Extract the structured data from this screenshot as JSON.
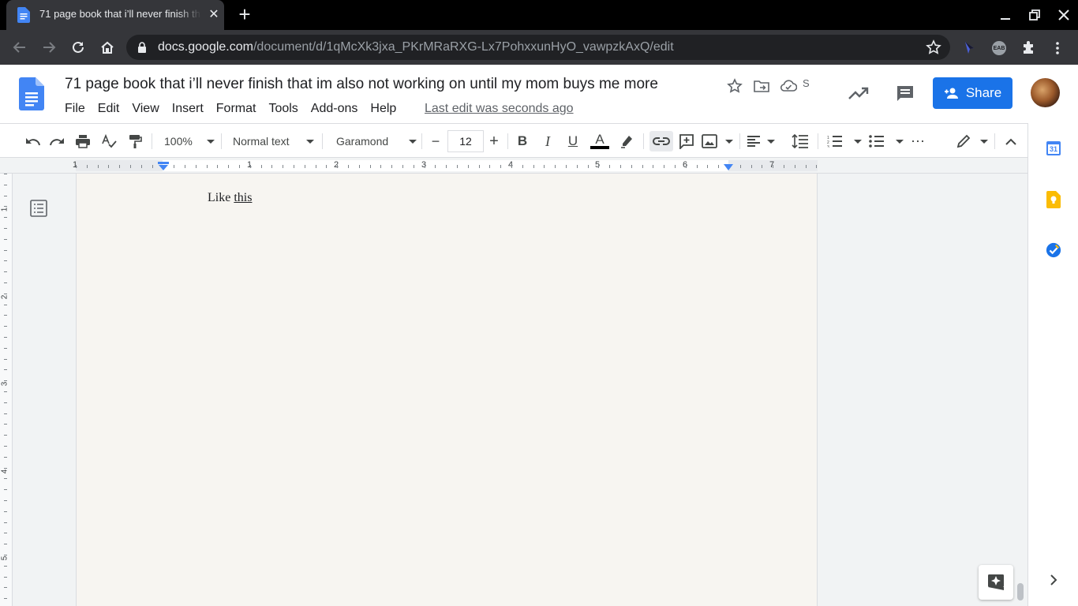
{
  "browser": {
    "tab_title": "71 page book that i’ll never finish that im also not working on until my mom buys me more",
    "tab_close": "✕",
    "new_tab": "+",
    "url_host": "docs.google.com",
    "url_path": "/document/d/1qMcXk3jxa_PKrMRaRXG-Lx7PohxxunHyO_vawpzkAxQ/edit",
    "extension_badge": "EAB"
  },
  "docs": {
    "title": "71 page book that i’ll never finish that im also not working on until my mom buys me more",
    "save_status": "S",
    "menus": [
      "File",
      "Edit",
      "View",
      "Insert",
      "Format",
      "Tools",
      "Add-ons",
      "Help"
    ],
    "last_edit": "Last edit was seconds ago",
    "share_label": "Share"
  },
  "toolbar": {
    "zoom": "100%",
    "style": "Normal text",
    "font": "Garamond",
    "font_size": "12",
    "minus": "−",
    "plus": "+",
    "bold": "B",
    "italic": "I",
    "underline": "U",
    "text_color": "A",
    "more": "⋯"
  },
  "ruler": {
    "numbers": [
      "1",
      "1",
      "2",
      "3",
      "4",
      "5",
      "6",
      "7"
    ],
    "vertical_numbers": [
      "1",
      "2",
      "3",
      "4",
      "5"
    ]
  },
  "document": {
    "text_prefix": "Like ",
    "text_link": "this"
  },
  "side_panel": {
    "calendar_day": "31"
  },
  "colors": {
    "accent": "#1a73e8",
    "page_background": "#f7f5f1",
    "chrome_dark": "#35363a"
  }
}
